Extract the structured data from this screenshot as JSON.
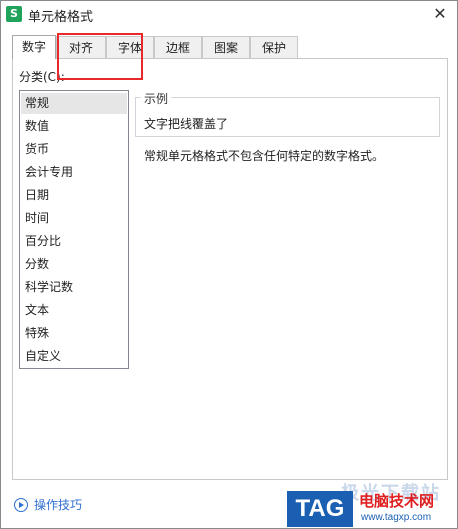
{
  "window": {
    "title": "单元格格式",
    "close_label": "✕",
    "app_icon_letter": "S"
  },
  "tabs": [
    {
      "label": "数字",
      "active": true
    },
    {
      "label": "对齐",
      "active": false
    },
    {
      "label": "字体",
      "active": false
    },
    {
      "label": "边框",
      "active": false
    },
    {
      "label": "图案",
      "active": false
    },
    {
      "label": "保护",
      "active": false
    }
  ],
  "category": {
    "label": "分类(C):",
    "items": [
      "常规",
      "数值",
      "货币",
      "会计专用",
      "日期",
      "时间",
      "百分比",
      "分数",
      "科学记数",
      "文本",
      "特殊",
      "自定义"
    ],
    "selected": "常规"
  },
  "sample": {
    "legend": "示例",
    "text": "文字把线覆盖了"
  },
  "description": "常规单元格格式不包含任何特定的数字格式。",
  "footer": {
    "tips_label": "操作技巧"
  },
  "watermark": {
    "top_text": "极光下载站",
    "logo_text": "TAG",
    "name": "电脑技术网",
    "url": "www.tagxp.com"
  },
  "colors": {
    "highlight": "#e8282b",
    "link": "#2e6fd0",
    "app_icon": "#21a35c"
  }
}
